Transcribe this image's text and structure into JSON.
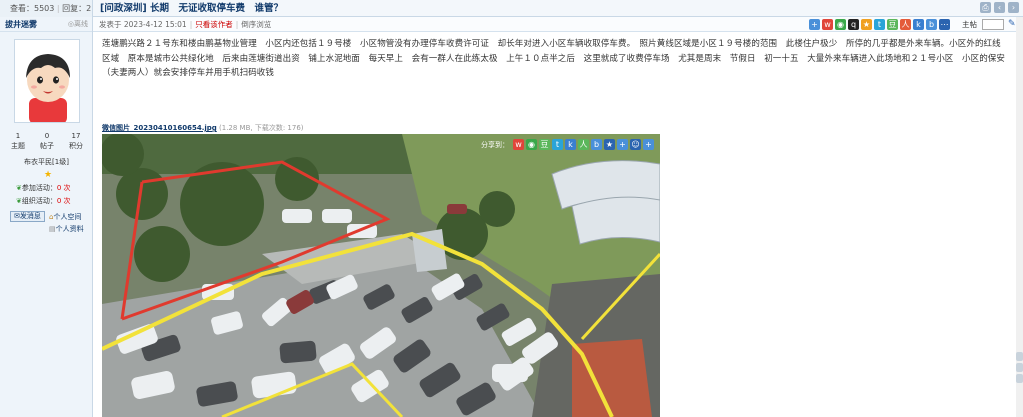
{
  "thread": {
    "views_label": "查看：",
    "views": "5503",
    "replies_label": "回复：",
    "replies": "2",
    "title": "[问政深圳] 长期　无证收取停车费　谁管？"
  },
  "author": {
    "name": "拔井迷雾",
    "status": "◎离线",
    "stats": [
      {
        "value": "1",
        "label": "主题"
      },
      {
        "value": "0",
        "label": "帖子"
      },
      {
        "value": "17",
        "label": "积分"
      }
    ],
    "rank": "布衣平民[1级]",
    "activity_join_label": "参加活动：",
    "activity_join_count": "0 次",
    "activity_org_label": "组织活动：",
    "activity_org_count": "0 次",
    "send_msg": "发消息",
    "space": "个人空间",
    "profile": "个人资料"
  },
  "meta": {
    "posted": "发表于 2023-4-12 15:01",
    "author_only": "只看该作者",
    "reverse": "倒序浏览",
    "floor_label": "主帖"
  },
  "post": {
    "body": "莲塘鹏兴路２１号东和楼由鹏基物业管理　小区内还包括１９号楼　小区物管没有办理停车收费许可证　却长年对进入小区车辆收取停车费。　照片黄线区域是小区１９号楼的范围　此楼住户极少　所停的几乎都是外来车辆。小区外的红线区域　原本是城市公共绿化地　后来由莲塘街道出资　铺上水泥地面　每天早上　会有一群人在此练太极　上午１０点半之后　这里就成了收费停车场　尤其是周末　节假日　初一十五　大量外来车辆进入此场地和２１号小区　小区的保安（夫妻两人）就会安排停车并用手机扫码收钱",
    "attachment_name": "微信图片_20230410160654.jpg",
    "attachment_info": "(1.28 MB, 下载次数: 176)",
    "share_label": "分享到："
  },
  "colors": {
    "link": "#113a6b",
    "red_zone": "#e03a2e",
    "yellow_zone": "#f2e23a"
  }
}
